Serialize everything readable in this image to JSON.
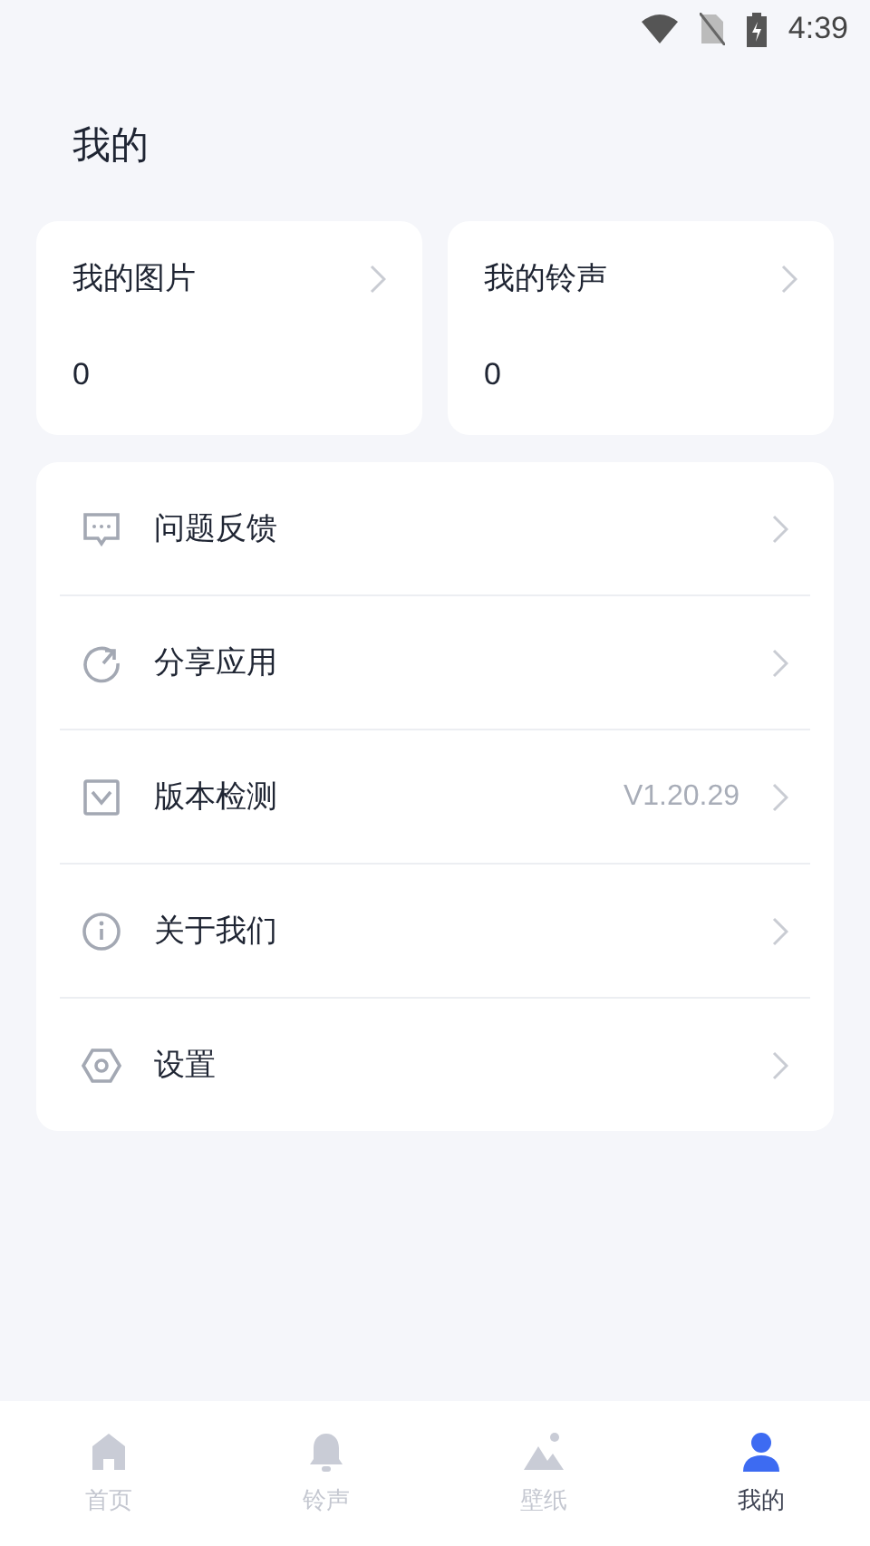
{
  "status_bar": {
    "time": "4:39"
  },
  "title": "我的",
  "summary_cards": [
    {
      "label": "我的图片",
      "count": "0"
    },
    {
      "label": "我的铃声",
      "count": "0"
    }
  ],
  "menu": [
    {
      "kind": "feedback",
      "label": "问题反馈"
    },
    {
      "kind": "share",
      "label": "分享应用"
    },
    {
      "kind": "version",
      "label": "版本检测",
      "value": "V1.20.29"
    },
    {
      "kind": "about",
      "label": "关于我们"
    },
    {
      "kind": "settings",
      "label": "设置"
    }
  ],
  "tabs": [
    {
      "kind": "home",
      "label": "首页",
      "selected": false
    },
    {
      "kind": "ringtone",
      "label": "铃声",
      "selected": false
    },
    {
      "kind": "wallpaper",
      "label": "壁纸",
      "selected": false
    },
    {
      "kind": "profile",
      "label": "我的",
      "selected": true
    }
  ]
}
